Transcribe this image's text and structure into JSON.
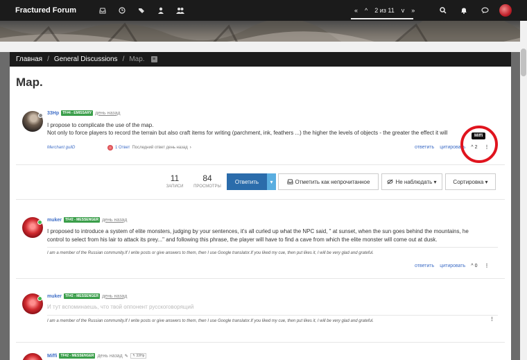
{
  "app": {
    "brand": "Fractured Forum",
    "nav_icons": [
      "inbox-icon",
      "clock-icon",
      "tags-icon",
      "user-icon",
      "users-icon"
    ],
    "pager": {
      "up_all": "«",
      "up": "^",
      "label": "2 из 11",
      "down": "v",
      "down_all": "»"
    },
    "right_icons": [
      "search-icon",
      "bell-icon",
      "chat-icon"
    ]
  },
  "breadcrumb": {
    "home": "Главная",
    "sep1": "/",
    "category": "General Discussions",
    "sep2": "/",
    "current": "Map.",
    "rss": "≡"
  },
  "page_title": "Map.",
  "posts": [
    {
      "username": "33Hp",
      "badge": "TF#4 - EMISSARY",
      "time": "день назад",
      "text_line1": "I propose to complicate the use of the map.",
      "text_line2": "Not only to force players to record the terrain but also craft items for writing (parchment, ink, feathers ...) the higher the levels of objects - the greater the effect it will",
      "signature_link": "Merchant guilD",
      "reply_count_text": "1 Ответ",
      "last_reply_text": "Последний ответ день назад",
      "reply_chevron": "›",
      "action_reply": "ответить",
      "action_quote": "цитировать",
      "likes_icon": "^",
      "likes": "2",
      "more": "⋮"
    },
    {
      "username": "muker",
      "badge": "TF#2 - MESSENGER",
      "time": "день назад",
      "text_line1": "I proposed to introduce a system of elite monsters, judging by your sentences, it's all curled up what the NPC said, \" at sunset, when the sun goes behind the mountains, he",
      "text_line2": "control to select from his lair to attack its prey...\" and following this phrase, the player will have to find a cave from which the elite monster will come out at dusk.",
      "signature": "I am a member of the Russian community.If I write posts or give answers to them, then I use Google translator.If you liked my cue, then put likes it, I will be very glad and grateful.",
      "action_reply": "ответить",
      "action_quote": "цитировать",
      "likes_icon": "^",
      "likes": "0",
      "more": "⋮"
    },
    {
      "username": "muker",
      "badge": "TF#2 - MESSENGER",
      "time": "день назад",
      "text_line1": "И тут вспоминаешь, что твой оппонент русскоговорящий",
      "signature": "I am a member of the Russian community.If I write posts or give answers to them, then I use Google translator.If you liked my cue, then put likes it, I will be very glad and grateful.",
      "more": "⋮"
    },
    {
      "username": "Miffi",
      "badge": "TF#2 - MESSENGER",
      "time": "день назад",
      "reply_to": "33Hp"
    }
  ],
  "stats": {
    "posts_count": "11",
    "posts_label": "ЗАПИСИ",
    "views_count": "84",
    "views_label": "ПРОСМОТРЫ"
  },
  "buttons": {
    "reply": "Ответить",
    "reply_dropdown": "▾",
    "mark_unread": "Отметить как непрочитанное",
    "watch": "Не наблюдать ▾",
    "sort": "Сортировка ▾"
  },
  "tooltip": "Miffi",
  "colors": {
    "navbar": "#1b1b1b",
    "link": "#3f6ec7",
    "badge_green": "#3a9e4a",
    "primary_button": "#2b6cab",
    "annotation_red": "#e0141e"
  }
}
